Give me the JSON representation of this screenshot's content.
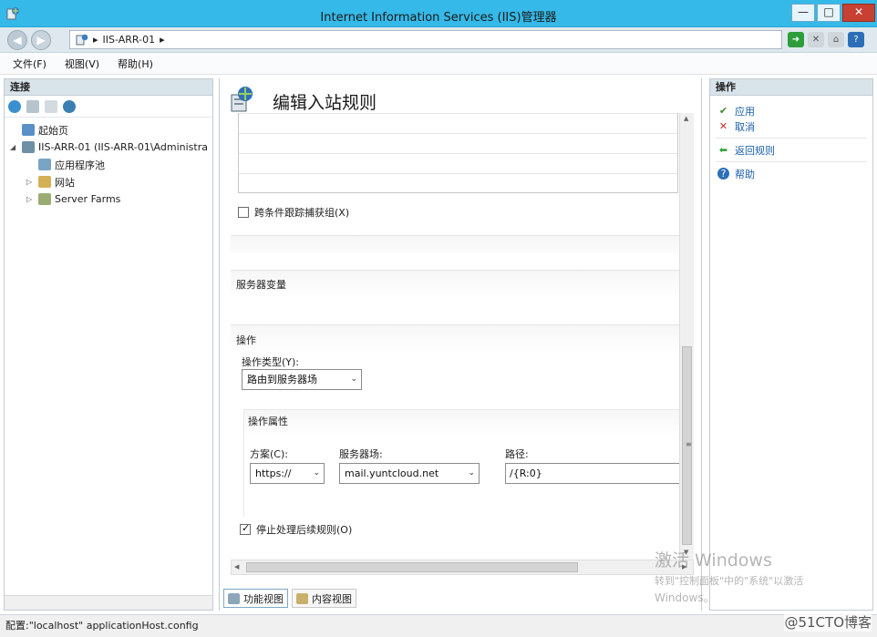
{
  "window": {
    "title": "Internet Information Services (IIS)管理器",
    "controls": {
      "minimize": "—",
      "maximize": "□",
      "close": "✕"
    }
  },
  "address": {
    "segments": [
      "▸",
      "IIS-ARR-01",
      "▸"
    ],
    "back_glyph": "◀",
    "forward_glyph": "▶"
  },
  "menu": [
    "文件(F)",
    "视图(V)",
    "帮助(H)"
  ],
  "connections": {
    "header": "连接",
    "tree": [
      {
        "label": "起始页",
        "icon": "start-page-icon",
        "level": 0,
        "expander": ""
      },
      {
        "label": "IIS-ARR-01 (IIS-ARR-01\\Administra",
        "icon": "server-icon",
        "level": 0,
        "expander": "◢"
      },
      {
        "label": "应用程序池",
        "icon": "app-pool-icon",
        "level": 1,
        "expander": ""
      },
      {
        "label": "网站",
        "icon": "sites-icon",
        "level": 1,
        "expander": "▷"
      },
      {
        "label": "Server Farms",
        "icon": "server-farms-icon",
        "level": 1,
        "expander": "▷"
      }
    ]
  },
  "center": {
    "page_title": "编辑入站规则",
    "track_captures_label": "跨条件跟踪捕获组(X)",
    "track_captures_checked": false,
    "server_variables_header": "服务器变量",
    "action_header": "操作",
    "action_type_label": "操作类型(Y):",
    "action_type_value": "路由到服务器场",
    "action_properties_header": "操作属性",
    "scheme_label": "方案(C):",
    "scheme_value": "https://",
    "server_farm_label": "服务器场:",
    "server_farm_value": "mail.yuntcloud.net",
    "path_label": "路径:",
    "path_value": "/{R:0}",
    "stop_processing_label": "停止处理后续规则(O)",
    "stop_processing_checked": true,
    "dropdown_arrow": "⌄",
    "view_tabs": [
      "功能视图",
      "内容视图"
    ]
  },
  "actions": {
    "header": "操作",
    "items": [
      {
        "label": "应用",
        "icon": "apply-icon",
        "glyph": "✔",
        "color": "#3a8a2a"
      },
      {
        "label": "取消",
        "icon": "cancel-icon",
        "glyph": "✕",
        "color": "#c0312b"
      },
      {
        "label": "返回规则",
        "icon": "back-to-rules-icon",
        "glyph": "⬅",
        "color": "#2f9e3a"
      },
      {
        "label": "帮助",
        "icon": "help-icon",
        "glyph": "?",
        "color": "#ffffff"
      }
    ]
  },
  "watermark": {
    "line1": "激活 Windows",
    "line2": "转到\"控制面板\"中的\"系统\"以激活",
    "line3": "Windows。",
    "corner": "@51CTO博客"
  },
  "status": {
    "text": "配置:\"localhost\" applicationHost.config"
  },
  "colors": {
    "titlebar": "#35b9e8",
    "link": "#1a5ea8"
  }
}
